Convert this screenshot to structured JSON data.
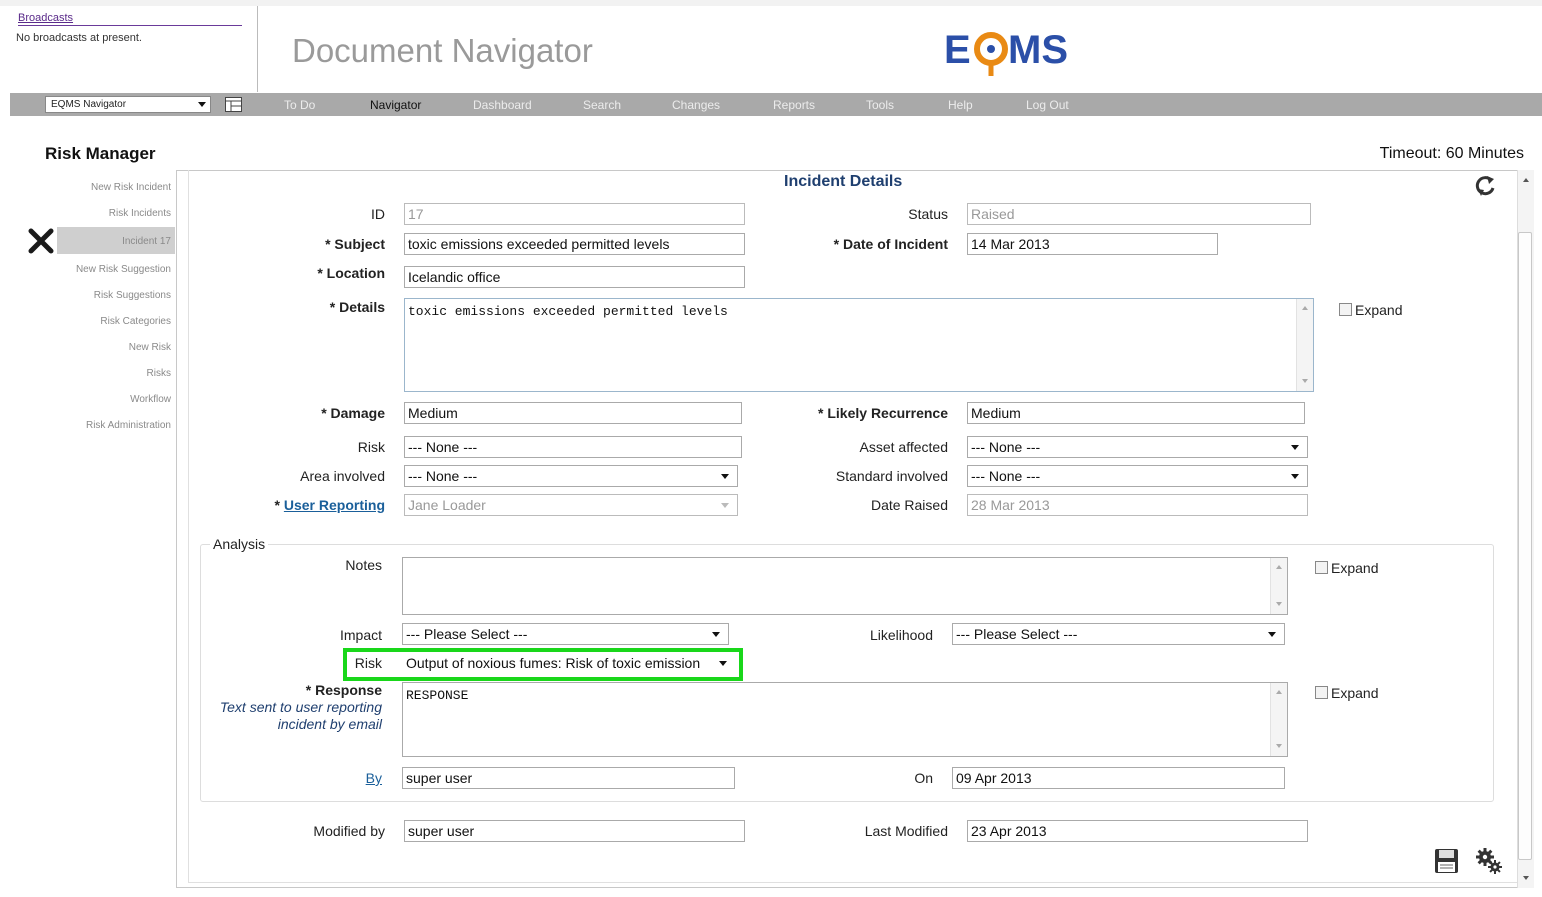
{
  "broadcasts": {
    "title": "Broadcasts",
    "message": "No broadcasts at present."
  },
  "app": {
    "title": "Document Navigator",
    "logo_text": "EQMS"
  },
  "nav": {
    "selector_value": "EQMS Navigator",
    "items": [
      "To Do",
      "Navigator",
      "Dashboard",
      "Search",
      "Changes",
      "Reports",
      "Tools",
      "Help",
      "Log Out"
    ],
    "active": "Navigator"
  },
  "page": {
    "title": "Risk Manager",
    "timeout": "Timeout: 60 Minutes"
  },
  "sidebar": {
    "items": [
      "New Risk Incident",
      "Risk Incidents",
      "Incident 17",
      "New Risk Suggestion",
      "Risk Suggestions",
      "Risk Categories",
      "New Risk",
      "Risks",
      "Workflow",
      "Risk Administration"
    ],
    "active": "Incident 17"
  },
  "incident": {
    "section_title": "Incident Details",
    "id_label": "ID",
    "id_value": "17",
    "status_label": "Status",
    "status_value": "Raised",
    "subject_label": "* Subject",
    "subject_value": "toxic emissions exceeded permitted levels",
    "date_label": "* Date of Incident",
    "date_value": "14 Mar 2013",
    "location_label": "* Location",
    "location_value": "Icelandic office",
    "details_label": "* Details",
    "details_value": "toxic emissions exceeded permitted levels",
    "expand_label": "Expand",
    "damage_label": "* Damage",
    "damage_value": "Medium",
    "recurrence_label": "* Likely Recurrence",
    "recurrence_value": "Medium",
    "risk_label": "Risk",
    "risk_value": "--- None ---",
    "asset_label": "Asset affected",
    "asset_value": "--- None ---",
    "area_label": "Area involved",
    "area_value": "--- None ---",
    "standard_label": "Standard involved",
    "standard_value": "--- None ---",
    "user_reporting_prefix": "* ",
    "user_reporting_label": "User Reporting",
    "user_reporting_value": "Jane Loader",
    "date_raised_label": "Date Raised",
    "date_raised_value": "28 Mar 2013"
  },
  "analysis": {
    "legend": "Analysis",
    "notes_label": "Notes",
    "notes_value": "",
    "expand_label": "Expand",
    "impact_label": "Impact",
    "impact_value": "--- Please Select ---",
    "likelihood_label": "Likelihood",
    "likelihood_value": "--- Please Select ---",
    "risk_label": "Risk",
    "risk_value": "Output of noxious fumes: Risk of toxic emission",
    "response_label": "* Response",
    "response_help": "Text sent to user reporting incident by email",
    "response_value": "RESPONSE",
    "by_label": "By",
    "by_value": "super user",
    "on_label": "On",
    "on_value": "09 Apr 2013"
  },
  "footer": {
    "modified_by_label": "Modified by",
    "modified_by_value": "super user",
    "last_modified_label": "Last Modified",
    "last_modified_value": "23 Apr 2013"
  },
  "colors": {
    "highlight": "#19d71a",
    "nav_bar": "#a9a9a9",
    "logo_blue": "#2b4fa8",
    "logo_orange": "#e98a14",
    "link": "#1a5f9a"
  },
  "icons": [
    "close-icon",
    "refresh-icon",
    "save-icon",
    "gear-icon",
    "grid-icon",
    "chevron-down-icon"
  ]
}
